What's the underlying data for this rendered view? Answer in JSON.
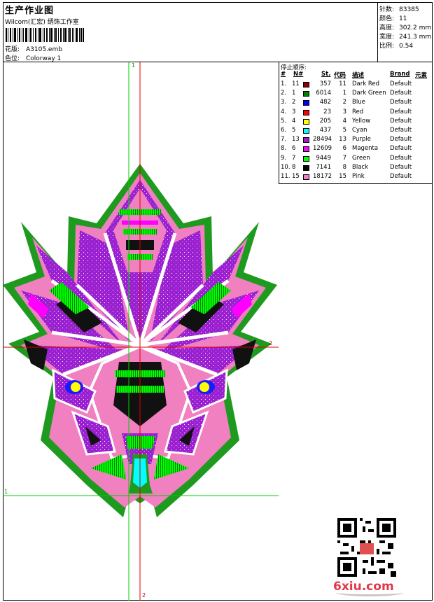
{
  "header": {
    "title": "生产作业图",
    "subtitle": "Wilcom(汇宏) 绣饰工作室",
    "design_label": "花版:",
    "design_value": "A3105.emb",
    "colorway_label": "色位:",
    "colorway_value": "Colorway 1"
  },
  "stats": [
    {
      "label": "针数:",
      "value": "83385"
    },
    {
      "label": "颜色:",
      "value": "11"
    },
    {
      "label": "高度:",
      "value": "302.2 mm"
    },
    {
      "label": "宽度:",
      "value": "241.3 mm"
    },
    {
      "label": "比例:",
      "value": "0.54"
    }
  ],
  "stop_sequence": {
    "title": "停止顺序:",
    "columns": [
      "#",
      "N#",
      "St.",
      "代码",
      "描述",
      "Brand",
      "元素"
    ],
    "rows": [
      {
        "n": "1.",
        "stop": "11",
        "color": "#8b0000",
        "st": "357",
        "code": "11",
        "desc": "Dark Red",
        "brand": "Default"
      },
      {
        "n": "2.",
        "stop": "1",
        "color": "#008000",
        "st": "6014",
        "code": "1",
        "desc": "Dark Green",
        "brand": "Default"
      },
      {
        "n": "3.",
        "stop": "2",
        "color": "#0000ff",
        "st": "482",
        "code": "2",
        "desc": "Blue",
        "brand": "Default"
      },
      {
        "n": "4.",
        "stop": "3",
        "color": "#ff0000",
        "st": "23",
        "code": "3",
        "desc": "Red",
        "brand": "Default"
      },
      {
        "n": "5.",
        "stop": "4",
        "color": "#ffff00",
        "st": "205",
        "code": "4",
        "desc": "Yellow",
        "brand": "Default"
      },
      {
        "n": "6.",
        "stop": "5",
        "color": "#00ffff",
        "st": "437",
        "code": "5",
        "desc": "Cyan",
        "brand": "Default"
      },
      {
        "n": "7.",
        "stop": "13",
        "color": "#9a1fd0",
        "st": "28494",
        "code": "13",
        "desc": "Purple",
        "brand": "Default"
      },
      {
        "n": "8.",
        "stop": "6",
        "color": "#ff00ff",
        "st": "12609",
        "code": "6",
        "desc": "Magenta",
        "brand": "Default"
      },
      {
        "n": "9.",
        "stop": "7",
        "color": "#00ff00",
        "st": "9449",
        "code": "7",
        "desc": "Green",
        "brand": "Default"
      },
      {
        "n": "10.",
        "stop": "8",
        "color": "#000000",
        "st": "7141",
        "code": "8",
        "desc": "Black",
        "brand": "Default"
      },
      {
        "n": "11.",
        "stop": "15",
        "color": "#f080c0",
        "st": "18172",
        "code": "15",
        "desc": "Pink",
        "brand": "Default"
      }
    ]
  },
  "guides": {
    "v1": "1",
    "h1": "1",
    "v2": "2",
    "h2": "2"
  },
  "watermark": "6xiu.com"
}
